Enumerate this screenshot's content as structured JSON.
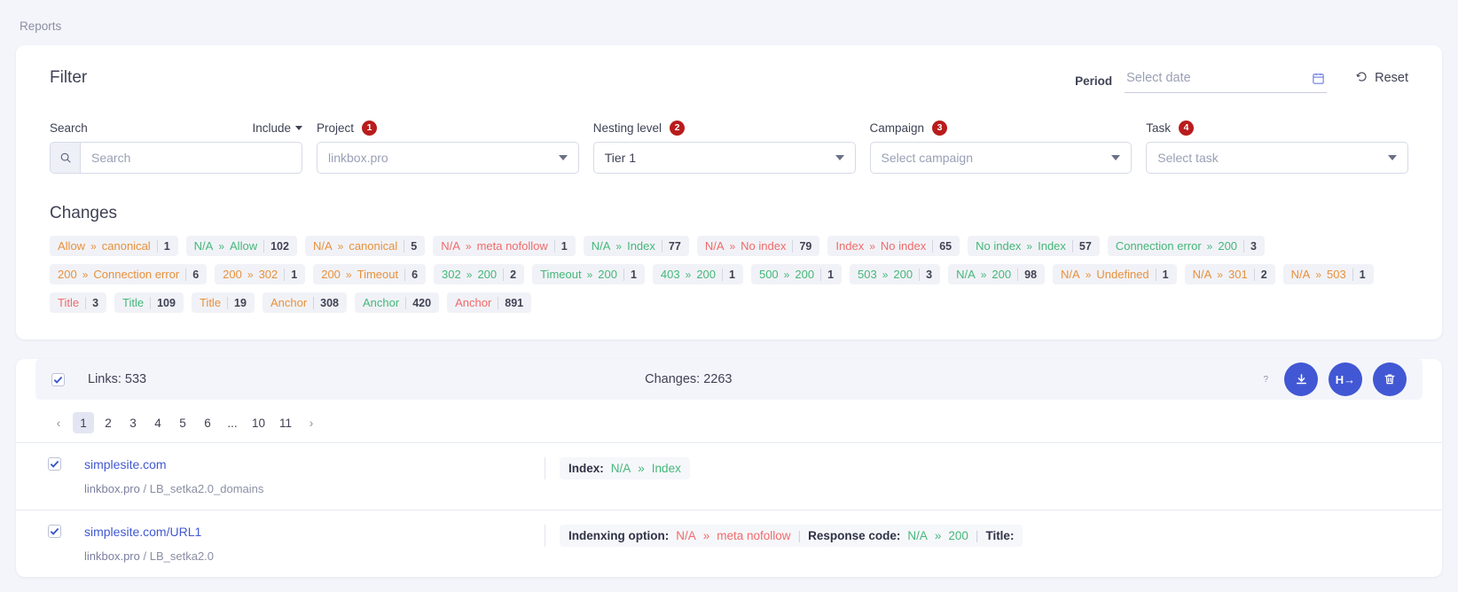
{
  "breadcrumb": "Reports",
  "filter": {
    "title": "Filter",
    "period_label": "Period",
    "period_placeholder": "Select date",
    "period_value": "",
    "calendar_icon": "calendar-icon",
    "reset_label": "Reset",
    "reset_icon": "reset-icon",
    "search": {
      "label": "Search",
      "placeholder": "Search",
      "value": "",
      "icon": "search-icon",
      "include_label": "Include"
    },
    "project": {
      "label": "Project",
      "badge": "1",
      "value": "linkbox.pro"
    },
    "nesting": {
      "label": "Nesting level",
      "badge": "2",
      "value": "Tier 1"
    },
    "campaign": {
      "label": "Campaign",
      "badge": "3",
      "value": "Select campaign"
    },
    "task": {
      "label": "Task",
      "badge": "4",
      "value": "Select task"
    }
  },
  "changes": {
    "title": "Changes",
    "tags": [
      {
        "from": "Allow",
        "to": "canonical",
        "count": "1",
        "from_color": "orange",
        "to_color": "orange"
      },
      {
        "from": "N/A",
        "to": "Allow",
        "count": "102",
        "from_color": "green",
        "to_color": "green"
      },
      {
        "from": "N/A",
        "to": "canonical",
        "count": "5",
        "from_color": "orange",
        "to_color": "orange"
      },
      {
        "from": "N/A",
        "to": "meta nofollow",
        "count": "1",
        "from_color": "red",
        "to_color": "red"
      },
      {
        "from": "N/A",
        "to": "Index",
        "count": "77",
        "from_color": "green",
        "to_color": "green"
      },
      {
        "from": "N/A",
        "to": "No index",
        "count": "79",
        "from_color": "red",
        "to_color": "red"
      },
      {
        "from": "Index",
        "to": "No index",
        "count": "65",
        "from_color": "red",
        "to_color": "red"
      },
      {
        "from": "No index",
        "to": "Index",
        "count": "57",
        "from_color": "green",
        "to_color": "green"
      },
      {
        "from": "Connection error",
        "to": "200",
        "count": "3",
        "from_color": "green",
        "to_color": "green"
      },
      {
        "from": "200",
        "to": "Connection error",
        "count": "6",
        "from_color": "orange",
        "to_color": "orange"
      },
      {
        "from": "200",
        "to": "302",
        "count": "1",
        "from_color": "orange",
        "to_color": "orange"
      },
      {
        "from": "200",
        "to": "Timeout",
        "count": "6",
        "from_color": "orange",
        "to_color": "orange"
      },
      {
        "from": "302",
        "to": "200",
        "count": "2",
        "from_color": "green",
        "to_color": "green"
      },
      {
        "from": "Timeout",
        "to": "200",
        "count": "1",
        "from_color": "green",
        "to_color": "green"
      },
      {
        "from": "403",
        "to": "200",
        "count": "1",
        "from_color": "green",
        "to_color": "green"
      },
      {
        "from": "500",
        "to": "200",
        "count": "1",
        "from_color": "green",
        "to_color": "green"
      },
      {
        "from": "503",
        "to": "200",
        "count": "3",
        "from_color": "green",
        "to_color": "green"
      },
      {
        "from": "N/A",
        "to": "200",
        "count": "98",
        "from_color": "green",
        "to_color": "green"
      },
      {
        "from": "N/A",
        "to": "Undefined",
        "count": "1",
        "from_color": "orange",
        "to_color": "orange"
      },
      {
        "from": "N/A",
        "to": "301",
        "count": "2",
        "from_color": "orange",
        "to_color": "orange"
      },
      {
        "from": "N/A",
        "to": "503",
        "count": "1",
        "from_color": "orange",
        "to_color": "orange"
      },
      {
        "from": "Title",
        "to": "",
        "count": "3",
        "from_color": "red",
        "to_color": "red"
      },
      {
        "from": "Title",
        "to": "",
        "count": "109",
        "from_color": "green",
        "to_color": "green"
      },
      {
        "from": "Title",
        "to": "",
        "count": "19",
        "from_color": "orange",
        "to_color": "orange"
      },
      {
        "from": "Anchor",
        "to": "",
        "count": "308",
        "from_color": "orange",
        "to_color": "orange"
      },
      {
        "from": "Anchor",
        "to": "",
        "count": "420",
        "from_color": "green",
        "to_color": "green"
      },
      {
        "from": "Anchor",
        "to": "",
        "count": "891",
        "from_color": "red",
        "to_color": "red"
      }
    ]
  },
  "results": {
    "select_all_checked": true,
    "links_label": "Links: 533",
    "changes_label": "Changes: 2263",
    "help_icon": "question-mark-icon",
    "buttons": [
      {
        "name": "download-button",
        "icon": "download-icon",
        "label": ""
      },
      {
        "name": "redirect-button",
        "icon": "http-redirect-icon",
        "label": "H"
      },
      {
        "name": "delete-button",
        "icon": "trash-icon",
        "label": ""
      }
    ],
    "pagination": {
      "prev": "‹",
      "next": "›",
      "pages": [
        "1",
        "2",
        "3",
        "4",
        "5",
        "6",
        "...",
        "10",
        "11"
      ],
      "active": "1"
    },
    "rows": [
      {
        "checked": true,
        "url": "simplesite.com",
        "project": "linkbox.pro",
        "separator": "/",
        "task": "LB_setka2.0_domains",
        "lines": [
          {
            "items": [
              {
                "label": "Index:",
                "from": "N/A",
                "to": "Index",
                "color": "green"
              }
            ]
          }
        ]
      },
      {
        "checked": true,
        "url": "simplesite.com/URL1",
        "project": "linkbox.pro",
        "separator": "/",
        "task": "LB_setka2.0",
        "lines": [
          {
            "items": [
              {
                "label": "Indenxing option:",
                "from": "N/A",
                "to": "meta nofollow",
                "color": "red"
              },
              {
                "label": "Response code:",
                "from": "N/A",
                "to": "200",
                "color": "green"
              },
              {
                "label": "Title:",
                "from": "",
                "to": "",
                "color": "green"
              }
            ]
          }
        ]
      }
    ]
  }
}
